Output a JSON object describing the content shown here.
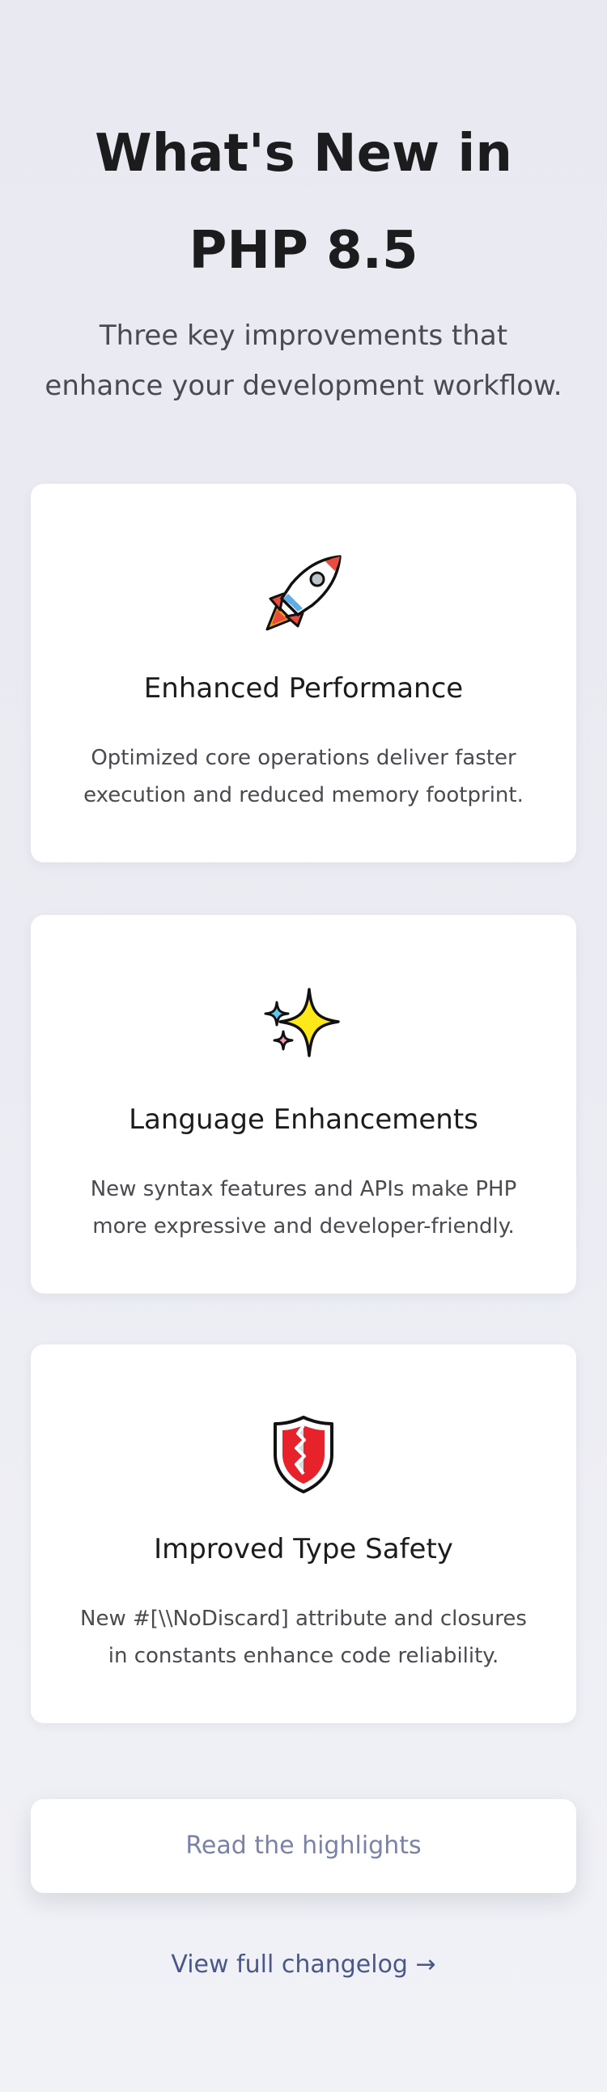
{
  "header": {
    "title": "What's New in PHP 8.5",
    "subtitle": "Three key improvements that enhance your development workflow."
  },
  "features": [
    {
      "icon": "rocket-icon",
      "title": "Enhanced Performance",
      "description": "Optimized core operations deliver faster execution and reduced memory footprint."
    },
    {
      "icon": "sparkles-icon",
      "title": "Language Enhancements",
      "description": "New syntax features and APIs make PHP more expressive and developer-friendly."
    },
    {
      "icon": "shield-icon",
      "title": "Improved Type Safety",
      "description": "New #[\\\\NoDiscard] attribute and closures in constants enhance code reliability."
    }
  ],
  "actions": {
    "highlights_label": "Read the highlights",
    "changelog_label": "View full changelog →"
  },
  "colors": {
    "background": "#eaebf2",
    "card": "#ffffff",
    "text": "#1c1c1e",
    "muted_text": "#4a4a50",
    "button_text": "#7a82a8",
    "link": "#4a5889"
  }
}
